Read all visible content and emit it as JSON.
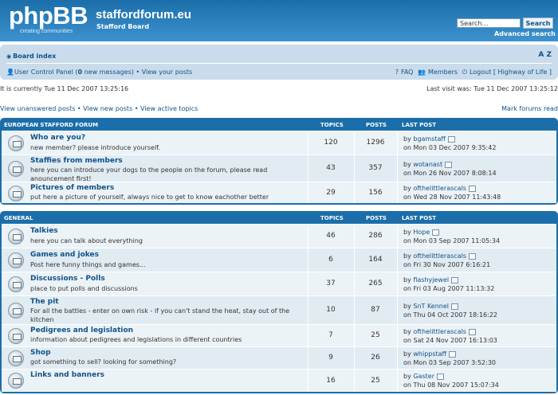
{
  "header": {
    "logo_text": "phpBB",
    "logo_tagline": "creating communities",
    "site_title": "staffordforum.eu",
    "site_subtitle": "Stafford Board",
    "search_placeholder": "Search…",
    "search_button": "Search",
    "advanced_search": "Advanced search"
  },
  "nav": {
    "board_index": "Board index",
    "font_size": "A Z",
    "ucp_text": "User Control Panel (",
    "ucp_count": "0",
    "ucp_msgs": " new messages) • View your posts",
    "faq": "FAQ",
    "members": "Members",
    "logout": "Logout [ Highway of Life ]"
  },
  "info": {
    "current_time": "It is currently Tue 11 Dec 2007 13:25:16",
    "last_visit": "Last visit was: Tue 11 Dec 2007 13:25:12",
    "view_links": "View unanswered posts • View new posts • View active topics",
    "mark_read": "Mark forums read"
  },
  "categories": [
    {
      "name": "EUROPEAN STAFFORD FORUM",
      "col_topics": "TOPICS",
      "col_posts": "POSTS",
      "col_lastpost": "LAST POST",
      "forums": [
        {
          "title": "Who are you?",
          "desc": "new member? please introduce yourself.",
          "topics": "120",
          "posts": "1296",
          "last_by": "bgamstaff",
          "last_date": "on Mon 03 Dec 2007 9:35:42"
        },
        {
          "title": "Staffies from members",
          "desc": "here you can introduce your dogs to the people on the forum, please read anouncement first!",
          "topics": "43",
          "posts": "357",
          "last_by": "wotanast",
          "last_date": "on Mon 26 Nov 2007 8:08:14"
        },
        {
          "title": "Pictures of members",
          "desc": "put here a picture of yourself, always nice to get to know eachother better",
          "topics": "29",
          "posts": "156",
          "last_by": "ofthelittlerascals",
          "last_date": "on Wed 28 Nov 2007 11:43:48"
        }
      ]
    },
    {
      "name": "GENERAL",
      "col_topics": "TOPICS",
      "col_posts": "POSTS",
      "col_lastpost": "LAST POST",
      "forums": [
        {
          "title": "Talkies",
          "desc": "here you can talk about everything",
          "topics": "46",
          "posts": "286",
          "last_by": "Hope",
          "last_date": "on Mon 03 Sep 2007 11:05:34"
        },
        {
          "title": "Games and jokes",
          "desc": "Post here funny things and games…",
          "topics": "6",
          "posts": "164",
          "last_by": "ofthelittlerascals",
          "last_date": "on Fri 30 Nov 2007 6:16:21"
        },
        {
          "title": "Discussions - Polls",
          "desc": "place to put polls and discussions",
          "topics": "37",
          "posts": "265",
          "last_by": "flashyjewel",
          "last_date": "on Fri 03 Aug 2007 11:13:32"
        },
        {
          "title": "The pit",
          "desc": "For all the battles - enter on own risk - if you can't stand the heat, stay out of the kitchen",
          "topics": "10",
          "posts": "87",
          "last_by": "SnT Kennel",
          "last_date": "on Thu 04 Oct 2007 18:16:22"
        },
        {
          "title": "Pedigrees and legislation",
          "desc": "information about pedigrees and legislations in different countries",
          "topics": "7",
          "posts": "25",
          "last_by": "ofthelittlerascals",
          "last_date": "on Sat 24 Nov 2007 16:13:03"
        },
        {
          "title": "Shop",
          "desc": "got something to sell? looking for something?",
          "topics": "9",
          "posts": "26",
          "last_by": "whippstaff",
          "last_date": "on Mon 03 Sep 2007 3:52:30"
        },
        {
          "title": "Links and banners",
          "desc": "",
          "topics": "16",
          "posts": "25",
          "last_by": "Gaster",
          "last_date": "on Thu 08 Nov 2007 15:07:34"
        }
      ]
    }
  ]
}
